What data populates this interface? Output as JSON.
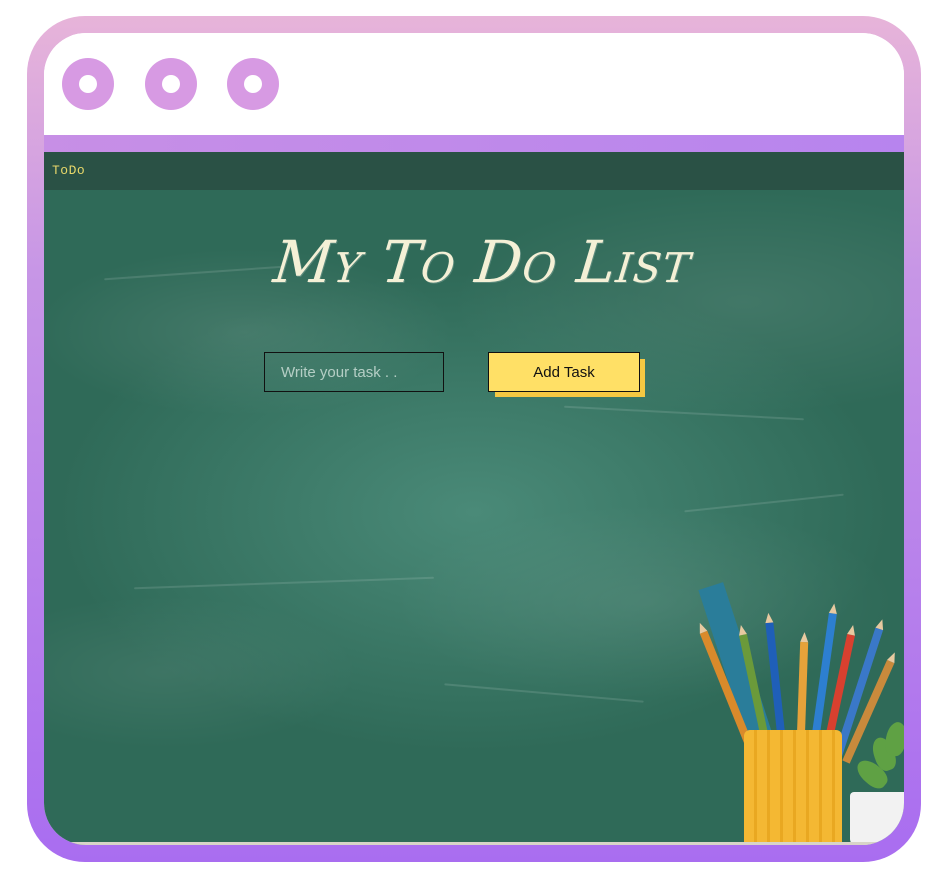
{
  "window": {
    "controls": [
      "window-dot-icon",
      "window-dot-icon",
      "window-dot-icon"
    ]
  },
  "navbar": {
    "brand": "ToDo"
  },
  "main": {
    "heading": "My To Do List",
    "task_input": {
      "value": "",
      "placeholder": "Write your task . ."
    },
    "add_button_label": "Add Task"
  },
  "colors": {
    "frame_gradient_top": "#e7b4d9",
    "frame_gradient_bottom": "#a96df0",
    "window_dot": "#d79ae3",
    "board": "#3c7a66",
    "brand_text": "#e8d86a",
    "heading_text": "#f4f0d6",
    "button_fill": "#ffe066",
    "button_shadow": "#f5c842"
  },
  "decor": {
    "background": "chalkboard-image",
    "pencil_cup": "pencil-cup-icon",
    "plant": "plant-icon"
  }
}
